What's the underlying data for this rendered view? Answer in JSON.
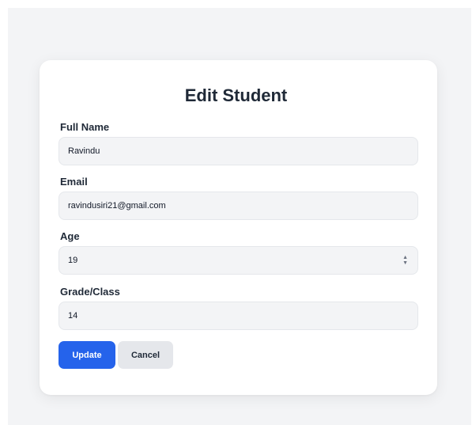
{
  "form": {
    "title": "Edit Student",
    "fields": [
      {
        "label": "Full Name",
        "value": "Ravindu"
      },
      {
        "label": "Email",
        "value": "ravindusiri21@gmail.com"
      },
      {
        "label": "Age",
        "value": "19"
      },
      {
        "label": "Grade/Class",
        "value": "14"
      }
    ],
    "buttons": {
      "update_label": "Update",
      "cancel_label": "Cancel"
    }
  },
  "icons": {
    "age_spinner": "stepper-arrows-icon"
  },
  "colors": {
    "primary": "#2563eb",
    "secondary_button": "#e5e7eb",
    "input_background": "#f3f4f6",
    "page_background": "#f3f4f6"
  }
}
